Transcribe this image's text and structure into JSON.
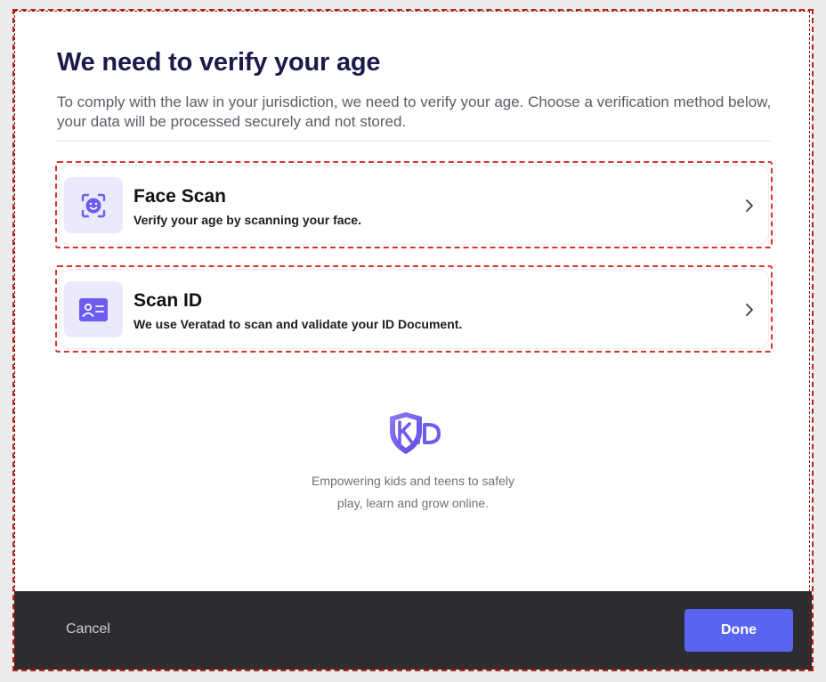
{
  "dialog": {
    "title": "We need to verify your age",
    "subtitle": "To comply with the law in your jurisdiction, we need to verify your age. Choose a verification method below, your data will be processed securely and not stored."
  },
  "options": [
    {
      "title": "Face Scan",
      "description": "Verify your age by scanning your face.",
      "icon": "face-scan-icon"
    },
    {
      "title": "Scan ID",
      "description": "We use Veratad to scan and validate your ID Document.",
      "icon": "id-card-icon"
    }
  ],
  "branding": {
    "logo": "kid-logo",
    "tagline_line1": "Empowering kids and teens to safely",
    "tagline_line2": "play, learn and grow online."
  },
  "footer": {
    "cancel_label": "Cancel",
    "done_label": "Done"
  },
  "colors": {
    "accent": "#5865f2",
    "icon_bg": "#ebeafc",
    "icon_fg": "#6d5cf0",
    "title": "#1c1a4a",
    "footer_bg": "#2b2d31",
    "highlight_dash": "#d9342b"
  }
}
